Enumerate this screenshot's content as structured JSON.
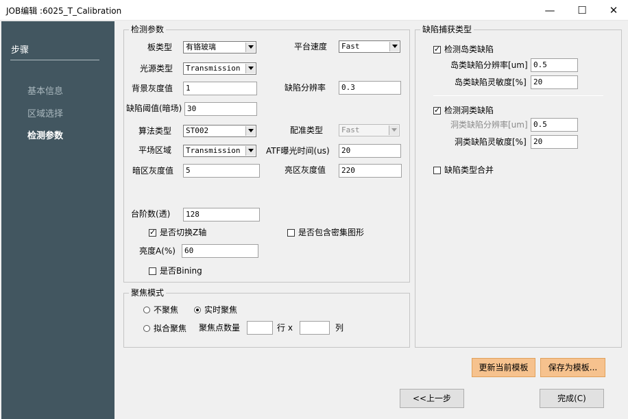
{
  "window": {
    "title": "JOB编辑 :6025_T_Calibration",
    "min": "—",
    "max": "☐",
    "close": "✕"
  },
  "sidebar": {
    "heading": "步骤",
    "items": [
      {
        "label": "基本信息"
      },
      {
        "label": "区域选择"
      },
      {
        "label": "检测参数"
      }
    ]
  },
  "detect": {
    "legend": "检测参数",
    "board_type": {
      "label": "板类型",
      "value": "有铬玻璃"
    },
    "platform_speed": {
      "label": "平台速度",
      "value": "Fast"
    },
    "light_type": {
      "label": "光源类型",
      "value": "Transmission"
    },
    "bg_gray": {
      "label": "背景灰度值",
      "value": "1"
    },
    "defect_resolution": {
      "label": "缺陷分辨率",
      "value": "0.3"
    },
    "defect_threshold": {
      "label": "缺陷阈值(暗场)",
      "value": "30"
    },
    "algorithm": {
      "label": "算法类型",
      "value": "ST002"
    },
    "align_type": {
      "label": "配准类型",
      "value": "Fast"
    },
    "flat_region": {
      "label": "平场区域",
      "value": "Transmission"
    },
    "atf_exposure": {
      "label": "ATF曝光时间(us)",
      "value": "20"
    },
    "dark_gray": {
      "label": "暗区灰度值",
      "value": "5"
    },
    "bright_gray": {
      "label": "亮区灰度值",
      "value": "220"
    },
    "steps": {
      "label": "台阶数(透)",
      "value": "128"
    },
    "switch_z": {
      "label": "是否切换Z轴",
      "mark": "✓"
    },
    "dense_pattern": {
      "label": "是否包含密集图形"
    },
    "brightness": {
      "label": "亮度A(%)",
      "value": "60"
    },
    "bining": {
      "label": "是否Bining"
    }
  },
  "focus": {
    "legend": "聚焦模式",
    "no_focus": {
      "label": "不聚焦"
    },
    "realtime_focus": {
      "label": "实时聚焦"
    },
    "fit_focus": {
      "label": "拟合聚焦"
    },
    "points_label": "聚焦点数量",
    "rows_value": "",
    "rows_unit": "行 x",
    "cols_value": "",
    "cols_unit": "列"
  },
  "capture": {
    "legend": "缺陷捕获类型",
    "island": {
      "label": "检测岛类缺陷",
      "mark": "✓"
    },
    "island_res": {
      "label": "岛类缺陷分辨率[um]",
      "value": "0.5"
    },
    "island_sens": {
      "label": "岛类缺陷灵敏度[%]",
      "value": "20"
    },
    "hole": {
      "label": "检测洞类缺陷",
      "mark": "✓"
    },
    "hole_res": {
      "label": "洞类缺陷分辨率[um]",
      "value": "0.5"
    },
    "hole_sens": {
      "label": "洞类缺陷灵敏度[%]",
      "value": "20"
    },
    "merge": {
      "label": "缺陷类型合并"
    }
  },
  "buttons": {
    "update_template": "更新当前模板",
    "save_template": "保存为模板...",
    "prev": "<<上一步",
    "finish": "完成(C)"
  }
}
